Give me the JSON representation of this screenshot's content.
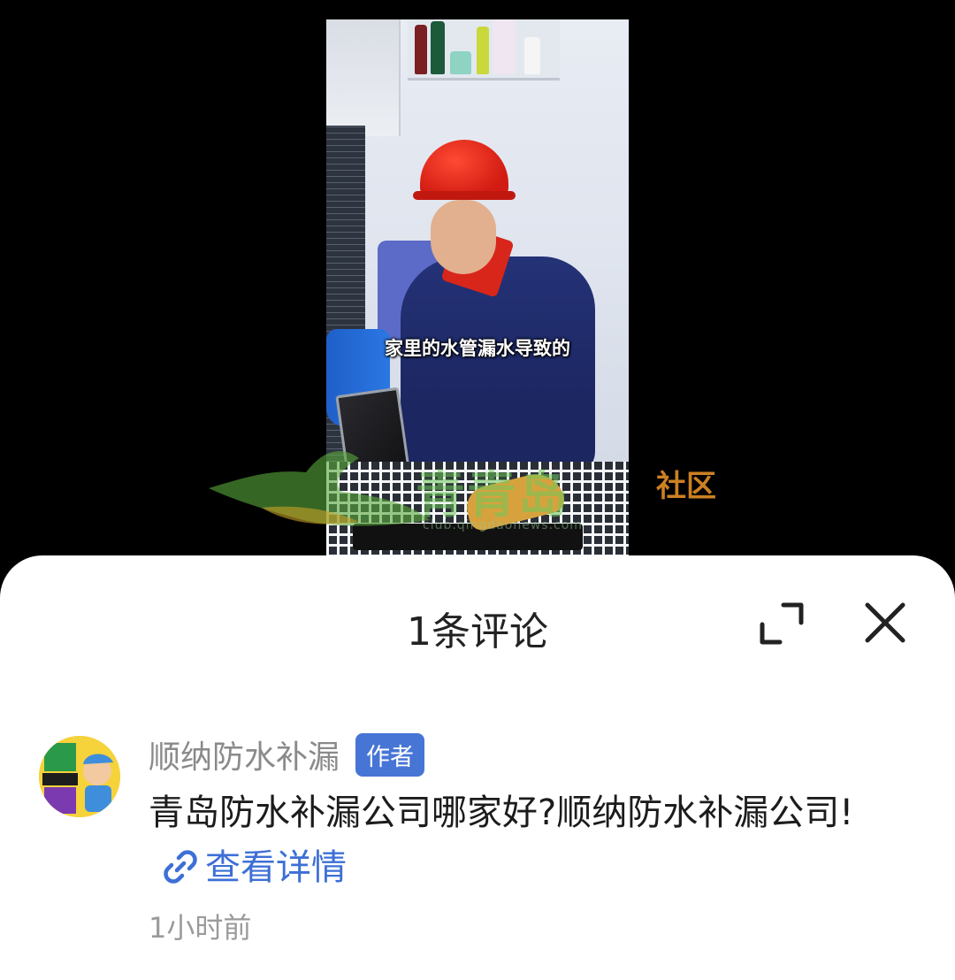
{
  "video": {
    "subtitle": "家里的水管漏水导致的",
    "watermark": {
      "brand": "青青岛",
      "community": "社区",
      "url": "club.qingdaonews.com"
    }
  },
  "comments_sheet": {
    "title": "1条评论",
    "expand_icon": "expand-icon",
    "close_icon": "close-icon",
    "comments": [
      {
        "author": "顺纳防水补漏",
        "badge": "作者",
        "text": "青岛防水补漏公司哪家好?顺纳防水补漏公司!",
        "link_label": "查看详情",
        "time": "1小时前"
      }
    ]
  },
  "colors": {
    "badge": "#4775d6",
    "link": "#3d6fd6",
    "sheet_bg": "#ffffff",
    "backdrop": "#000000"
  }
}
